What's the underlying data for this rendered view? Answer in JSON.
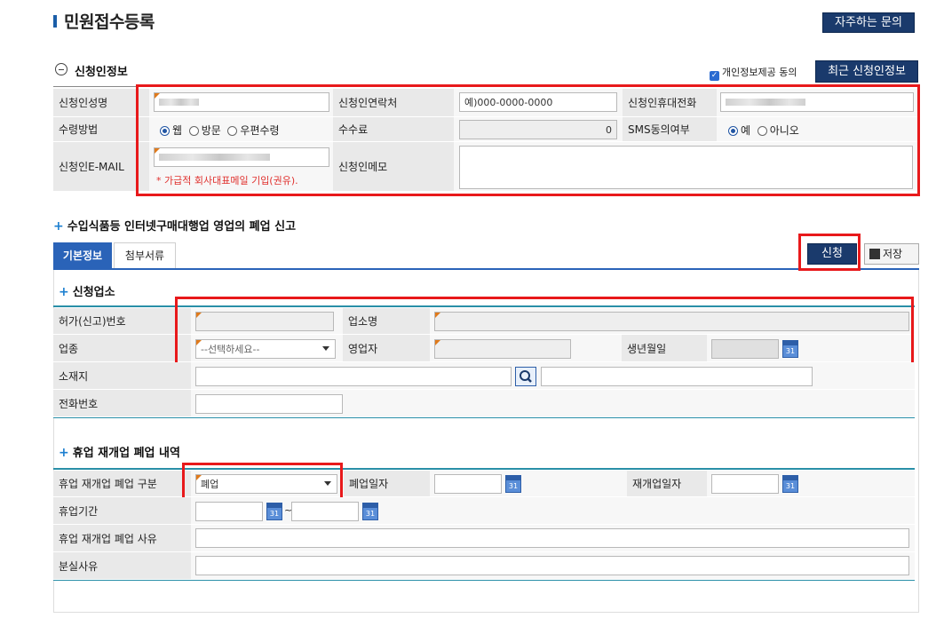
{
  "page": {
    "title": "민원접수등록",
    "faq_button": "자주하는 문의"
  },
  "applicant": {
    "section_title": "신청인정보",
    "privacy_checkbox_label": "개인정보제공 동의",
    "recent_button": "최근 신청인정보",
    "name_label": "신청인성명",
    "contact_label": "신청인연락처",
    "contact_value": "예)000-0000-0000",
    "mobile_label": "신청인휴대전화",
    "receive_label": "수령방법",
    "receive_options": [
      "웹",
      "방문",
      "우편수령"
    ],
    "fee_label": "수수료",
    "fee_value": "0",
    "sms_label": "SMS동의여부",
    "sms_options": [
      "예",
      "아니오"
    ],
    "email_label": "신청인E-MAIL",
    "email_note": "* 가급적 회사대표메일 기입(권유).",
    "memo_label": "신청인메모"
  },
  "report": {
    "title": "수입식품등 인터넷구매대행업 영업의 폐업 신고",
    "tabs": [
      "기본정보",
      "첨부서류"
    ],
    "apply_button": "신청",
    "save_button": "저장"
  },
  "business": {
    "section_title": "신청업소",
    "permit_label": "허가(신고)번호",
    "biz_name_label": "업소명",
    "biz_type_label": "업종",
    "biz_type_placeholder": "--선택하세요--",
    "operator_label": "영업자",
    "birth_label": "생년월일",
    "address_label": "소재지",
    "phone_label": "전화번호"
  },
  "closure": {
    "section_title": "휴업 재개업 폐업 내역",
    "type_label": "휴업 재개업 폐업 구분",
    "type_value": "폐업",
    "close_date_label": "폐업일자",
    "reopen_date_label": "재개업일자",
    "suspend_period_label": "휴업기간",
    "tilde": "~",
    "reason_label": "휴업 재개업 폐업 사유",
    "loss_reason_label": "분실사유"
  },
  "icons": {
    "calendar_text": "31"
  },
  "colors": {
    "navy": "#1a3a6c",
    "highlight": "#e8191b",
    "teal_border": "#2a8fa8",
    "required_marker": "#e07a1b"
  }
}
